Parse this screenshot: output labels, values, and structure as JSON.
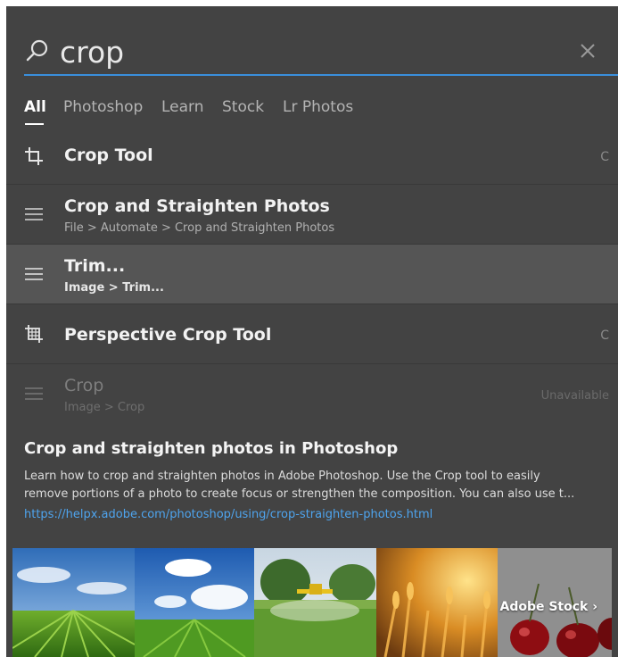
{
  "search": {
    "query": "crop"
  },
  "tabs": [
    {
      "label": "All",
      "active": true
    },
    {
      "label": "Photoshop"
    },
    {
      "label": "Learn"
    },
    {
      "label": "Stock"
    },
    {
      "label": "Lr Photos"
    }
  ],
  "results": [
    {
      "icon": "crop-tool-icon",
      "title": "Crop Tool",
      "path": "",
      "shortcut": "C"
    },
    {
      "icon": "menu-icon",
      "title": "Crop and Straighten Photos",
      "path": "File > Automate > Crop and Straighten Photos",
      "shortcut": ""
    },
    {
      "icon": "menu-icon",
      "title": "Trim...",
      "path": "Image > Trim...",
      "shortcut": "",
      "selected": true
    },
    {
      "icon": "perspective-crop-icon",
      "title": "Perspective Crop Tool",
      "path": "",
      "shortcut": "C"
    },
    {
      "icon": "menu-icon",
      "title": "Crop",
      "path": "Image > Crop",
      "shortcut": "Unavailable",
      "disabled": true
    }
  ],
  "learn": {
    "title": "Crop and straighten photos in Photoshop",
    "description_line1": "Learn how to crop and straighten photos in Adobe Photoshop. Use the Crop tool to easily",
    "description_line2": "remove portions of a photo to create focus or strengthen the composition. You can also use t...",
    "url": "https://helpx.adobe.com/photoshop/using/crop-straighten-photos.html"
  },
  "stock": {
    "link_label": "Adobe Stock ›",
    "thumbnails": [
      "crop-field-photo",
      "green-field-sky-photo",
      "crop-duster-plane-photo",
      "wheat-sunset-photo",
      "cherries-photo"
    ]
  },
  "colors": {
    "panel_bg": "#434343",
    "selected_row_bg": "#555555",
    "accent_underline": "#3a8fdc",
    "link": "#4ea4ee"
  }
}
